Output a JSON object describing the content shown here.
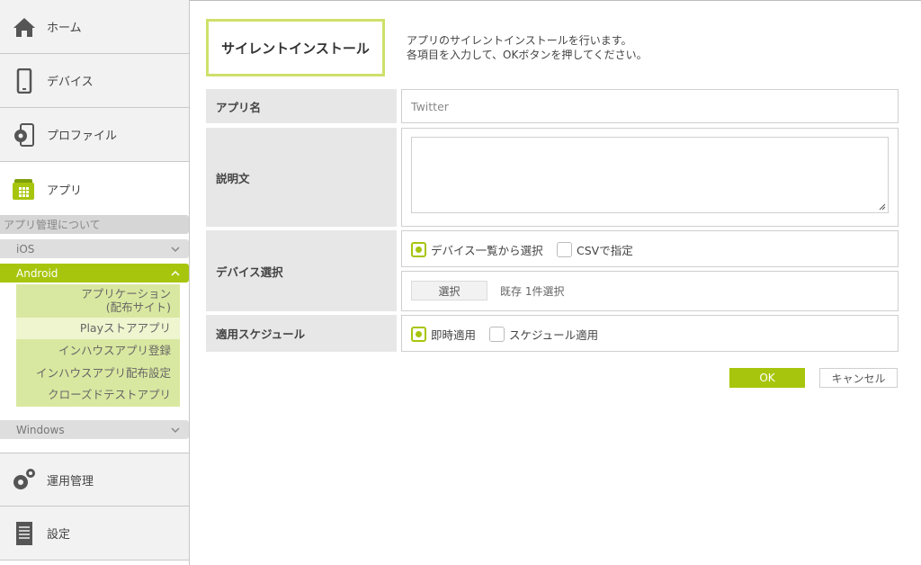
{
  "sidebar": {
    "home": "ホーム",
    "device": "デバイス",
    "profile": "プロファイル",
    "app": "アプリ",
    "app_about": "アプリ管理について",
    "ios": "iOS",
    "android": "Android",
    "android_items": [
      "アプリケーション",
      "(配布サイト)",
      "Playストアアプリ",
      "インハウスアプリ登録",
      "インハウスアプリ配布設定",
      "クローズドテストアプリ"
    ],
    "windows": "Windows",
    "operation": "運用管理",
    "settings": "設定"
  },
  "header": {
    "title": "サイレントインストール",
    "desc_line1": "アプリのサイレントインストールを行います。",
    "desc_line2": "各項目を入力して、OKボタンを押してください。"
  },
  "form": {
    "app_name_label": "アプリ名",
    "app_name_value": "Twitter",
    "description_label": "説明文",
    "description_value": "",
    "device_label": "デバイス選択",
    "device_option1": "デバイス一覧から選択",
    "device_option2": "CSVで指定",
    "select_button": "選択",
    "selection_info": "既存 1件選択",
    "schedule_label": "適用スケジュール",
    "schedule_option1": "即時適用",
    "schedule_option2": "スケジュール適用"
  },
  "buttons": {
    "ok": "OK",
    "cancel": "キャンセル"
  },
  "colors": {
    "accent": "#a8c50d",
    "accent_light": "#d9e8a0",
    "title_border": "#cfe06a"
  }
}
